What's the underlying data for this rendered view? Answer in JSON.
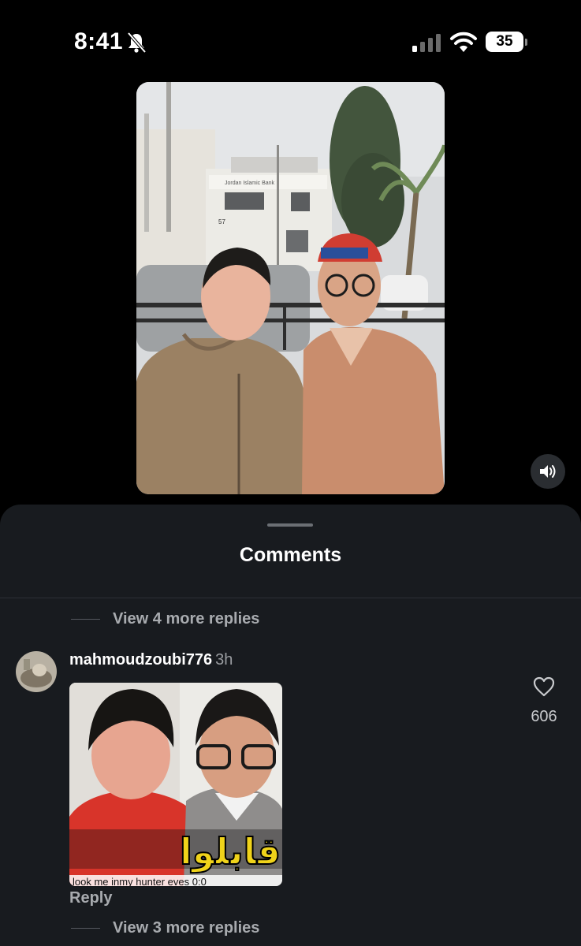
{
  "status_bar": {
    "time": "8:41",
    "battery_level": "35",
    "icons": [
      "bell-slash-icon",
      "signal-icon",
      "wifi-icon",
      "battery-icon"
    ]
  },
  "video": {
    "bank_sign": "Jordan Islamic Bank",
    "building_number": "57",
    "sound_icon": "speaker-icon"
  },
  "comments_sheet": {
    "title": "Comments",
    "view_more_top": "View 4 more replies",
    "comment": {
      "username": "mahmoudzoubi776",
      "time_ago": "3h",
      "media_overlay_text": "قابلوا",
      "media_caption": "look me inmy hunter eves 0:0",
      "reply_label": "Reply",
      "like_count": "606"
    },
    "view_more_bottom": "View 3 more replies"
  },
  "colors": {
    "background": "#000000",
    "sheet": "#181b1f",
    "muted_text": "#a8abaf"
  }
}
